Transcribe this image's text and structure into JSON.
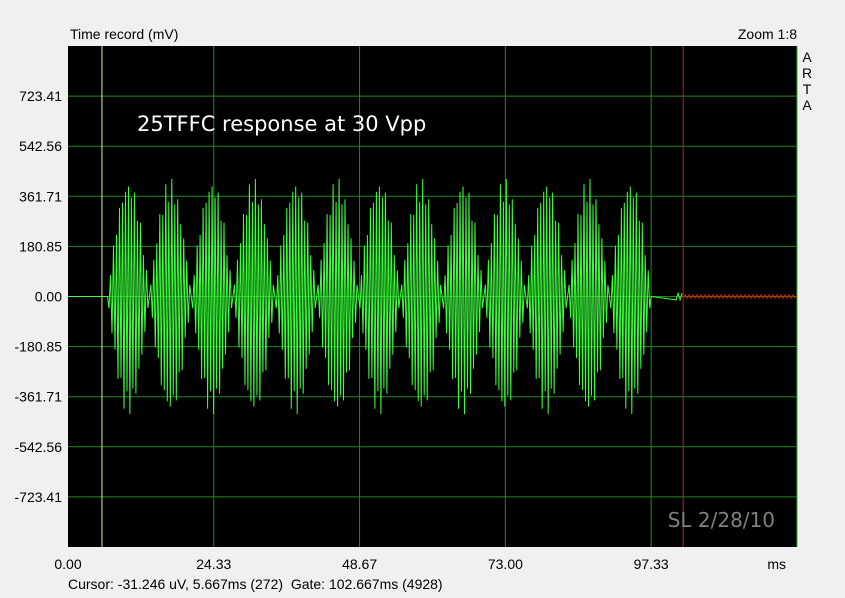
{
  "window": {
    "title": "Time record (mV)",
    "zoom": "Zoom 1:8",
    "brand_letters": [
      "A",
      "R",
      "T",
      "A"
    ]
  },
  "colors": {
    "background": "#f0f0f0",
    "plot_bg": "#000000",
    "grid": "#1e8a1e",
    "signal": "#3cff3c",
    "gate_signal": "#d22000",
    "cursor_line": "#e6e690",
    "gate_line": "#b22222",
    "annotation": "#ffffff",
    "watermark": "#808080"
  },
  "status": {
    "cursor": "Cursor: -31.246 uV, 5.667ms (272)",
    "gate": "Gate: 102.667ms (4928)"
  },
  "chart_data": {
    "type": "line",
    "title": "Time record (mV)",
    "annotation": "25TFFC response at 30 Vpp",
    "watermark": "SL 2/28/10",
    "xlabel": "ms",
    "ylabel": "mV",
    "xlim": [
      0,
      121.67
    ],
    "ylim": [
      -904.26,
      904.26
    ],
    "x_ticks": [
      "0.00",
      "24.33",
      "48.67",
      "73.00",
      "97.33"
    ],
    "x_tick_values": [
      0,
      24.33,
      48.67,
      73.0,
      97.33
    ],
    "y_ticks": [
      "723.41",
      "542.56",
      "361.71",
      "180.85",
      "0.00",
      "-180.85",
      "-361.71",
      "-542.56",
      "-723.41"
    ],
    "y_tick_values": [
      723.41,
      542.56,
      361.71,
      180.85,
      0,
      -180.85,
      -361.71,
      -542.56,
      -723.41
    ],
    "grid": true,
    "cursor_ms": 5.667,
    "gate_ms": 102.667,
    "series": [
      {
        "description": "tone bursts",
        "bursts": 13,
        "start_ms": 6.6,
        "period_ms": 6.98,
        "peak_mV": 430,
        "end_ms": 101.5
      }
    ]
  }
}
